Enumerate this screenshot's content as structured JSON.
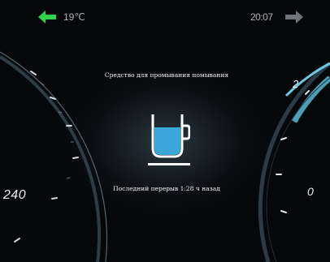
{
  "status_bar": {
    "temperature": "19℃",
    "time": "20:07",
    "left_arrow_icon": "green-left-arrow-icon",
    "right_arrow_icon": "gray-right-arrow-icon",
    "left_arrow_color": "#2fd34a",
    "right_arrow_color": "#6f7478"
  },
  "message": {
    "title": "Средство для промывания помывания",
    "cup_icon": "cup-icon",
    "cup_fill_color": "#3aa7d8",
    "bottom_text": "Последний перерыв 1:28 ч назад"
  },
  "left_gauge": {
    "label": "240"
  },
  "right_gauge": {
    "label_top": "2",
    "label_bottom": "0",
    "accent_color": "#6cc9e6"
  }
}
